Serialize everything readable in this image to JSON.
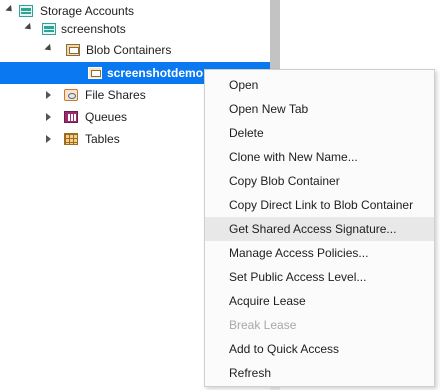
{
  "tree": {
    "storage_accounts": "Storage Accounts",
    "account": "screenshots",
    "blob_containers": "Blob Containers",
    "selected_container": "screenshotdemo",
    "file_shares": "File Shares",
    "queues": "Queues",
    "tables": "Tables"
  },
  "context_menu": {
    "items": [
      {
        "label": "Open"
      },
      {
        "label": "Open New Tab"
      },
      {
        "label": "Delete"
      },
      {
        "label": "Clone with New Name..."
      },
      {
        "label": "Copy Blob Container"
      },
      {
        "label": "Copy Direct Link to Blob Container"
      },
      {
        "label": "Get Shared Access Signature...",
        "state": "hovered"
      },
      {
        "label": "Manage Access Policies..."
      },
      {
        "label": "Set Public Access Level..."
      },
      {
        "label": "Acquire Lease"
      },
      {
        "label": "Break Lease",
        "state": "disabled"
      },
      {
        "label": "Add to Quick Access"
      },
      {
        "label": "Refresh"
      }
    ]
  },
  "colors": {
    "selection": "#0a78f0",
    "menu_hover": "#e8e8e8",
    "disabled_text": "#a8a8a8"
  }
}
